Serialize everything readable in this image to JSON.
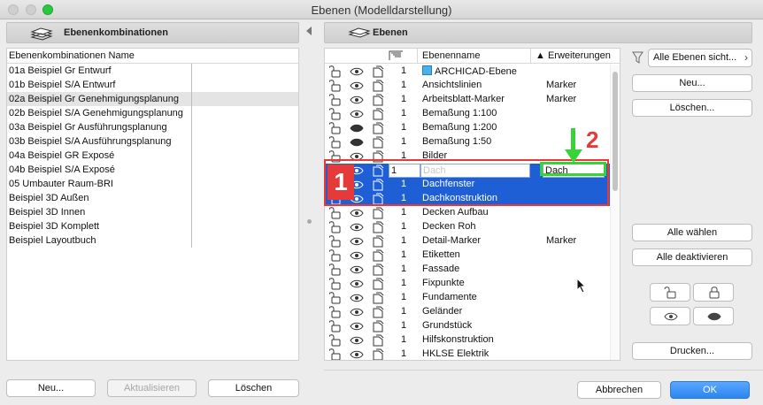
{
  "window": {
    "title": "Ebenen (Modelldarstellung)"
  },
  "left_panel": {
    "header": "Ebenenkombinationen",
    "column_header": "Ebenenkombinationen Name",
    "items": [
      "01a Beispiel Gr Entwurf",
      "01b Beispiel S/A Entwurf",
      "02a Beispiel Gr Genehmigungsplanung",
      "02b Beispiel S/A Genehmigungsplanung",
      "03a Beispiel Gr Ausführungsplanung",
      "03b Beispiel S/A Ausführungsplanung",
      "04a Beispiel GR Exposé",
      "04b Beispiel S/A Exposé",
      "05 Umbauter Raum-BRI",
      "Beispiel 3D Außen",
      "Beispiel 3D Innen",
      "Beispiel 3D Komplett",
      "Beispiel Layoutbuch"
    ],
    "selected_index": 2,
    "buttons": {
      "new": "Neu...",
      "update": "Aktualisieren",
      "delete": "Löschen"
    }
  },
  "right_panel": {
    "header": "Ebenen",
    "columns": {
      "name": "Ebenenname",
      "ext": "▲ Erweiterungen"
    },
    "rows": [
      {
        "num": "1",
        "name": "ARCHICAD-Ebene",
        "ext": "",
        "eye": "open",
        "special": true
      },
      {
        "num": "1",
        "name": "Ansichtslinien",
        "ext": "Marker",
        "eye": "open"
      },
      {
        "num": "1",
        "name": "Arbeitsblatt-Marker",
        "ext": "Marker",
        "eye": "open"
      },
      {
        "num": "1",
        "name": "Bemaßung 1:100",
        "ext": "",
        "eye": "open"
      },
      {
        "num": "1",
        "name": "Bemaßung 1:200",
        "ext": "",
        "eye": "closed"
      },
      {
        "num": "1",
        "name": "Bemaßung 1:50",
        "ext": "",
        "eye": "closed"
      },
      {
        "num": "1",
        "name": "Bilder",
        "ext": "",
        "eye": "open"
      },
      {
        "num": "1",
        "name": "Dach",
        "ext": "Dach",
        "eye": "open",
        "editing": true
      },
      {
        "num": "1",
        "name": "Dachfenster",
        "ext": "",
        "eye": "open",
        "selected": true
      },
      {
        "num": "1",
        "name": "Dachkonstruktion",
        "ext": "",
        "eye": "open",
        "selected": true
      },
      {
        "num": "1",
        "name": "Decken Aufbau",
        "ext": "",
        "eye": "open"
      },
      {
        "num": "1",
        "name": "Decken Roh",
        "ext": "",
        "eye": "open"
      },
      {
        "num": "1",
        "name": "Detail-Marker",
        "ext": "Marker",
        "eye": "open"
      },
      {
        "num": "1",
        "name": "Etiketten",
        "ext": "",
        "eye": "open"
      },
      {
        "num": "1",
        "name": "Fassade",
        "ext": "",
        "eye": "open"
      },
      {
        "num": "1",
        "name": "Fixpunkte",
        "ext": "",
        "eye": "open"
      },
      {
        "num": "1",
        "name": "Fundamente",
        "ext": "",
        "eye": "open"
      },
      {
        "num": "1",
        "name": "Geländer",
        "ext": "",
        "eye": "open"
      },
      {
        "num": "1",
        "name": "Grundstück",
        "ext": "",
        "eye": "open"
      },
      {
        "num": "1",
        "name": "Hilfskonstruktion",
        "ext": "",
        "eye": "open"
      },
      {
        "num": "1",
        "name": "HKLSE Elektrik",
        "ext": "",
        "eye": "open"
      }
    ]
  },
  "controls": {
    "dropdown": "Alle Ebenen sicht...",
    "new": "Neu...",
    "delete": "Löschen...",
    "select_all": "Alle wählen",
    "deactivate_all": "Alle deaktivieren",
    "print": "Drucken...",
    "cancel": "Abbrechen",
    "ok": "OK"
  },
  "annotations": {
    "badge1": "1",
    "badge2": "2"
  },
  "colors": {
    "selection": "#1f5fd6",
    "annotation_red": "#e53a3a",
    "annotation_green": "#37d437",
    "ok_blue": "#2b85ee"
  }
}
